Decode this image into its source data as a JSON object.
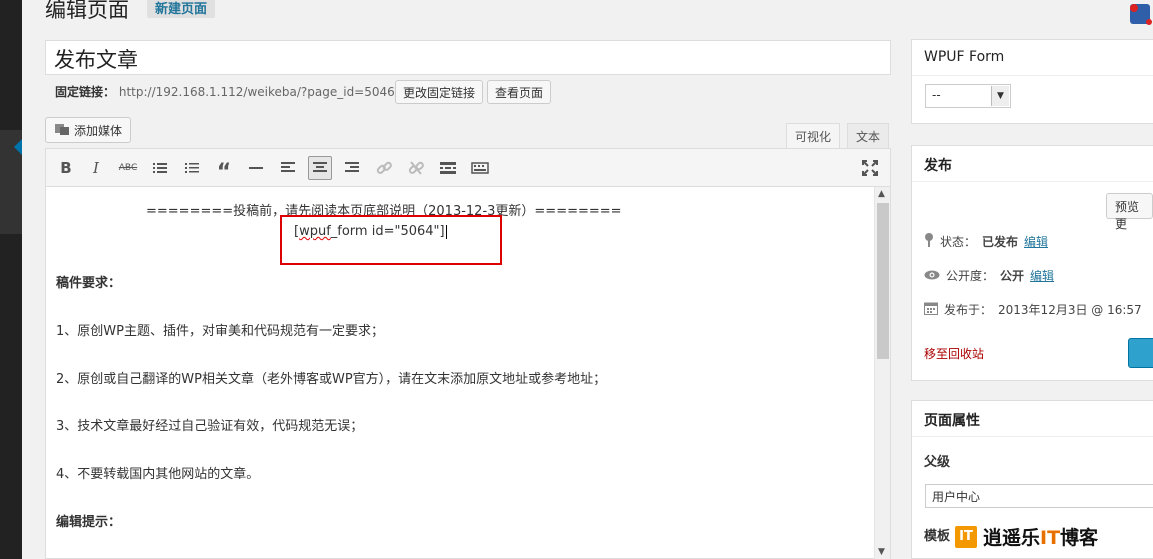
{
  "page": {
    "title": "编辑页面",
    "add_new": "新建页面"
  },
  "post": {
    "title": "发布文章"
  },
  "permalink": {
    "label": "固定链接：",
    "url": "http://192.168.1.112/weikeba/?page_id=5046",
    "change_button": "更改固定链接",
    "view_button": "查看页面"
  },
  "editor": {
    "add_media": "添加媒体",
    "tab_visual": "可视化",
    "tab_text": "文本",
    "lines": [
      "========投稿前，请先阅读本页底部说明（2013-12-3更新）========",
      "[wpuf_form id=\"5064\"]",
      "稿件要求：",
      "1、原创WP主题、插件，对审美和代码规范有一定要求；",
      "2、原创或自己翻译的WP相关文章（老外博客或WP官方），请在文末添加原文地址或参考地址；",
      "3、技术文章最好经过自己验证有效，代码规范无误；",
      "4、不要转载国内其他网站的文章。",
      "编辑提示："
    ],
    "shortcode_parts": {
      "open": "[",
      "word": "wpuf",
      "rest": "_form id=\"5064\"]"
    }
  },
  "toolbar_icons": [
    "bold-icon",
    "italic-icon",
    "strikethrough-icon",
    "bullet-list-icon",
    "numbered-list-icon",
    "blockquote-icon",
    "horizontal-rule-icon",
    "align-left-icon",
    "align-center-icon",
    "align-right-icon",
    "link-icon",
    "unlink-icon",
    "read-more-icon",
    "toolbar-toggle-icon",
    "fullscreen-icon"
  ],
  "sidebar": {
    "wpuf": {
      "title": "WPUF Form",
      "selected": "--"
    },
    "publish": {
      "title": "发布",
      "preview": "预览更",
      "status_label": "状态：",
      "status_value": "已发布",
      "visibility_label": "公开度：",
      "visibility_value": "公开",
      "published_label": "发布于：",
      "published_value": "2013年12月3日 @ 16:57",
      "edit": "编辑",
      "trash": "移至回收站"
    },
    "attributes": {
      "title": "页面属性",
      "parent_label": "父级",
      "parent_value": "用户中心",
      "template_label": "模板"
    }
  },
  "watermark": {
    "logo": "IT",
    "text_a": "逍遥乐",
    "text_it": "IT",
    "text_b": "博客"
  },
  "colors": {
    "accent": "#21759b",
    "highlight": "#dd0000",
    "sidebar_dark": "#222222"
  }
}
